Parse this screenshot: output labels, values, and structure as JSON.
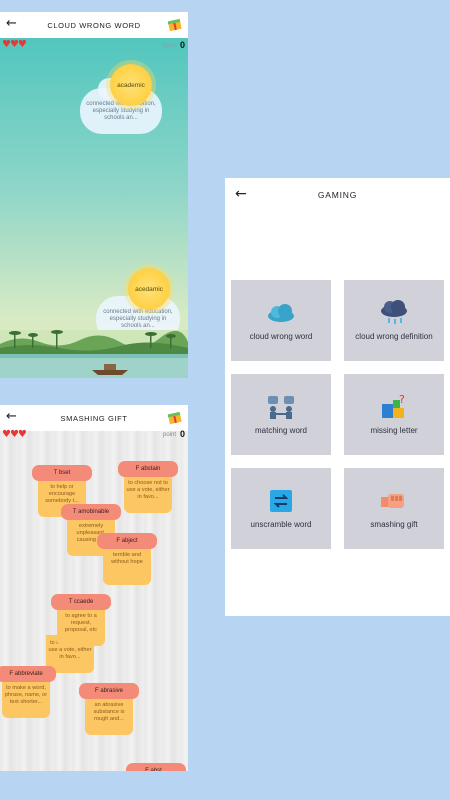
{
  "cloud_screen": {
    "title": "CLOUD WRONG WORD",
    "hearts": "♥♥♥",
    "point_label": "point",
    "point_value": "0",
    "suns": [
      {
        "word": "academic",
        "definition": "connected with education, especially studying in schools an..."
      },
      {
        "word": "acedamic",
        "definition": "connected with education, especially studying in schools an..."
      }
    ]
  },
  "gift_screen": {
    "title": "SMASHING GIFT",
    "hearts": "♥♥♥",
    "point_label": "point",
    "point_value": "0",
    "cards": [
      {
        "label": "T bset",
        "text": "to help or encourage somebody t..."
      },
      {
        "label": "F abstain",
        "text": "to choose not to use a vote, either in favo..."
      },
      {
        "label": "T amobinable",
        "text": "extremely unpleasant, causing h..."
      },
      {
        "label": "F abject",
        "text": "terrible and without hope"
      },
      {
        "label": "T ccaede",
        "text": "to agree to a request, proposal, etc"
      },
      {
        "label": "",
        "text": "to choose not to use a vote, either in favo..."
      },
      {
        "label": "F abbreviate",
        "text": "to make a word, phrase, name, or text shorter..."
      },
      {
        "label": "F abrasive",
        "text": "an abrasive substance is rough and..."
      },
      {
        "label": "F abst...",
        "text": ""
      }
    ]
  },
  "menu_screen": {
    "title": "GAMING",
    "tiles": [
      {
        "label": "cloud wrong word",
        "icon": "cloud-icon"
      },
      {
        "label": "cloud wrong definition",
        "icon": "rain-cloud-icon"
      },
      {
        "label": "matching word",
        "icon": "matching-icon"
      },
      {
        "label": "missing letter",
        "icon": "puzzle-icon"
      },
      {
        "label": "unscramble word",
        "icon": "swap-icon"
      },
      {
        "label": "smashing gift",
        "icon": "fist-icon"
      }
    ]
  },
  "colors": {
    "background": "#b7d5f3",
    "tile": "#d0d1d9",
    "card_header": "#f48b78",
    "card_body": "#fcc763",
    "heart": "#e53935"
  }
}
